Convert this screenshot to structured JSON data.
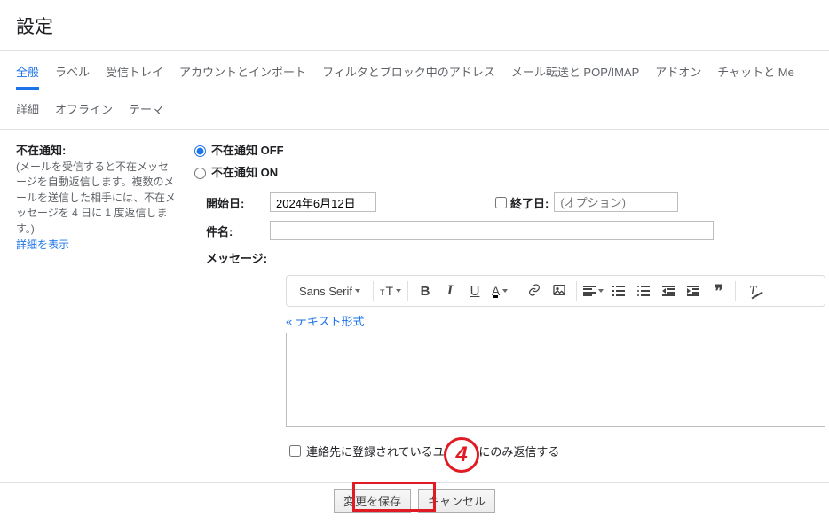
{
  "page_title": "設定",
  "tabs": [
    "全般",
    "ラベル",
    "受信トレイ",
    "アカウントとインポート",
    "フィルタとブロック中のアドレス",
    "メール転送と POP/IMAP",
    "アドオン",
    "チャットと Me",
    "詳細",
    "オフライン",
    "テーマ"
  ],
  "active_tab_index": 0,
  "vacation": {
    "section_label": "不在通知:",
    "section_desc": "(メールを受信すると不在メッセージを自動返信します。複数のメールを送信した相手には、不在メッセージを 4 日に 1 度返信します。)",
    "details_link": "詳細を表示",
    "off_label": "不在通知 OFF",
    "on_label": "不在通知 ON",
    "radio_selected": "off",
    "start_label": "開始日:",
    "start_value": "2024年6月12日",
    "end_label": "終了日:",
    "end_placeholder": "(オプション)",
    "end_checked": false,
    "subject_label": "件名:",
    "subject_value": "",
    "message_label": "メッセージ:",
    "font_family_label": "Sans Serif",
    "plain_text_link": "テキスト形式",
    "message_value": "",
    "contacts_only_text": "連絡先に登録されているユーザーにのみ返信する",
    "contacts_only_checked": false
  },
  "footer": {
    "save_label": "変更を保存",
    "cancel_label": "キャンセル"
  },
  "annotation": {
    "number": "4"
  }
}
